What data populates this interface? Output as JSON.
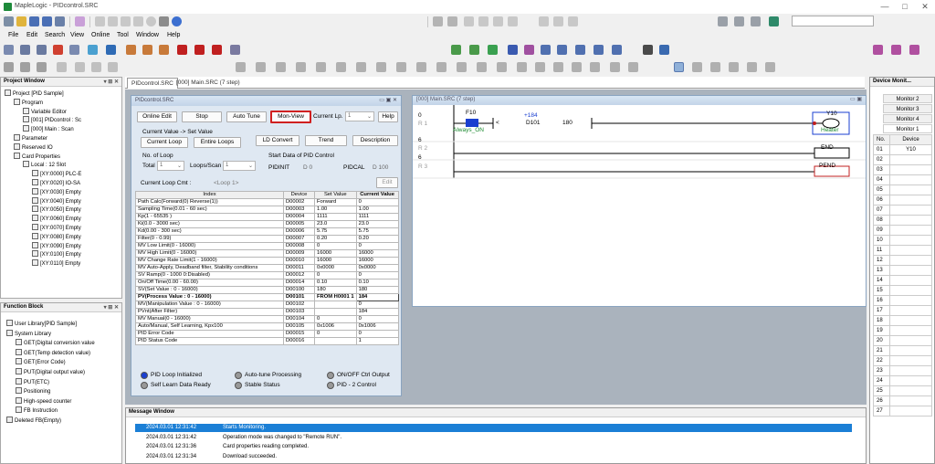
{
  "app": {
    "title": "MapleLogic - PIDcontrol.SRC"
  },
  "window_controls": [
    "—",
    "□",
    "✕"
  ],
  "menu": [
    "File",
    "Edit",
    "Search",
    "View",
    "Online",
    "Tool",
    "Window",
    "Help"
  ],
  "tabs": [
    "PIDcontrol.SRC",
    "[000] Main.SRC (7 step)"
  ],
  "project": {
    "title": "Project Window",
    "items": [
      {
        "label": "Project [PID Sample]",
        "level": 0
      },
      {
        "label": "Program",
        "level": 1
      },
      {
        "label": "Variable Editor",
        "level": 2
      },
      {
        "label": "[001] PIDcontrol : Sc",
        "level": 2
      },
      {
        "label": "[000] Main : Scan",
        "level": 2
      },
      {
        "label": "Parameter",
        "level": 1
      },
      {
        "label": "Reserved IO",
        "level": 1
      },
      {
        "label": "Card Properties",
        "level": 1
      },
      {
        "label": "Local : 12 Slot",
        "level": 2
      },
      {
        "label": "[XY:0000] PLC-E",
        "level": 3
      },
      {
        "label": "[XY:0020] IO-SA",
        "level": 3
      },
      {
        "label": "[XY:0030] Empty",
        "level": 3
      },
      {
        "label": "[XY:0040] Empty",
        "level": 3
      },
      {
        "label": "[XY:0050] Empty",
        "level": 3
      },
      {
        "label": "[XY:0060] Empty",
        "level": 3
      },
      {
        "label": "[XY:0070] Empty",
        "level": 3
      },
      {
        "label": "[XY:0080] Empty",
        "level": 3
      },
      {
        "label": "[XY:0090] Empty",
        "level": 3
      },
      {
        "label": "[XY:0100] Empty",
        "level": 3
      },
      {
        "label": "[XY:0110] Empty",
        "level": 3
      }
    ]
  },
  "function_block": {
    "title": "Function Block",
    "items": [
      {
        "label": "User Library[PID Sample]",
        "level": 0
      },
      {
        "label": "System Library",
        "level": 0
      },
      {
        "label": "GET(Digital conversion value",
        "level": 1
      },
      {
        "label": "GET(Temp detection value)",
        "level": 1
      },
      {
        "label": "GET(Error Code)",
        "level": 1
      },
      {
        "label": "PUT(Digital output value)",
        "level": 1
      },
      {
        "label": "PUT(ETC)",
        "level": 1
      },
      {
        "label": "Positioning",
        "level": 1
      },
      {
        "label": "High-speed counter",
        "level": 1
      },
      {
        "label": "FB Instruction",
        "level": 1
      },
      {
        "label": "Deleted FB(Empty)",
        "level": 0
      }
    ]
  },
  "pid": {
    "title": "PIDcontrol.SRC",
    "buttons": {
      "online_edit": "Online Edit",
      "stop": "Stop",
      "auto_tune": "Auto Tune",
      "mon_view": "Mon-View",
      "help": "Help",
      "current_loop": "Current Loop",
      "entire_loops": "Entire Loops",
      "ld_convert": "LD Convert",
      "trend": "Trend",
      "description": "Description",
      "edit": "Edit"
    },
    "current_lp_label": "Current Lp.",
    "current_lp_value": "1",
    "current_value_label": "Current Value -> Set Value",
    "no_of_loop_label": "No. of Loop",
    "total_label": "Total",
    "total_value": "1",
    "loops_scan_label": "Loops/Scan",
    "loops_scan_value": "1",
    "start_data_label": "Start Data of PID Control",
    "pidinit_label": "PIDINIT",
    "pidinit_value": "D 0",
    "pidcal_label": "PIDCAL",
    "pidcal_value": "D 100",
    "loop_cmt_label": "Current Loop Cmt :",
    "loop_cmt_value": "<Loop 1>",
    "headers": [
      "Index",
      "Device",
      "Set Value",
      "Current Value"
    ],
    "rows": [
      [
        "Path Calc(Forward(0) Reverse(1))",
        "D00002",
        "Forward",
        "0"
      ],
      [
        "Sampling Time(0.01 - 60 sec)",
        "D00003",
        "1.00",
        "1.00"
      ],
      [
        "Kp(1 - 65535 )",
        "D00004",
        "1111",
        "1111"
      ],
      [
        "Ki(0.0 - 3000 sec)",
        "D00005",
        "23.0",
        "23.0"
      ],
      [
        "Kd(0.00 - 300 sec)",
        "D00006",
        "5.75",
        "5.75"
      ],
      [
        "Filter(0 - 0.99)",
        "D00007",
        "0.20",
        "0.20"
      ],
      [
        "MV Low Limit(0 - 16000)",
        "D00008",
        "0",
        "0"
      ],
      [
        "MV High Limit(0 - 16000)",
        "D00009",
        "16000",
        "16000"
      ],
      [
        "MV Change Rate Limit(1 - 16000)",
        "D00010",
        "16000",
        "16000"
      ],
      [
        "MV Auto-Apply, Deadband filter, Stability conditions",
        "D00011",
        "0x0000",
        "0x0000"
      ],
      [
        "SV Ramp(0 - 1000   0:Disabled)",
        "D00012",
        "0",
        "0"
      ],
      [
        "On/Off Time(0.00 - 60.00)",
        "D00014",
        "0.10",
        "0.10"
      ],
      [
        "SV(Set Value : 0 - 16000)",
        "D00100",
        "180",
        "180"
      ],
      [
        "PV(Process Value : 0 - 16000)",
        "D00101",
        "FROM H0001 1",
        "184"
      ],
      [
        "MV(Manipulation Value : 0 - 16000)",
        "D00102",
        "",
        "0"
      ],
      [
        "PVnt(After Filter)",
        "D00103",
        "",
        "184"
      ],
      [
        "MV Manual(0 - 16000)",
        "D00104",
        "0",
        "0"
      ],
      [
        "Auto/Manual, Self Learning, Kpx100",
        "D00105",
        "0x1006",
        "0x1006"
      ],
      [
        "PID Error Code",
        "D00015",
        "0",
        "0"
      ],
      [
        "PID Status Code",
        "D00016",
        "",
        "1"
      ]
    ],
    "status": {
      "loop_init": "PID Loop Initialized",
      "auto_tune_proc": "Auto-tune Processing",
      "onoff": "ON/OFF Ctrl Output",
      "self_learn": "Self Learn Data Ready",
      "stable": "Stable Status",
      "pid2": "PID - 2 Control"
    }
  },
  "ladder": {
    "title": "[000] Main.SRC (7 step)",
    "contact": "F10",
    "contact_comment": "Always_ON",
    "compare_op": "<",
    "compare_const": "+184",
    "compare_dev": "D101",
    "compare_val": "180",
    "coil": "Y10",
    "coil_comment": "Heater",
    "end": "END",
    "pend": "PEND",
    "steps": [
      "0",
      "6",
      "6"
    ],
    "rungs": [
      "R 1",
      "R 2",
      "R 3"
    ]
  },
  "message": {
    "title": "Message Window",
    "lines": [
      {
        "time": "2024.03.01 12:31:42",
        "text": "Starts Monitoring."
      },
      {
        "time": "2024.03.01 12:31:42",
        "text": "Operation mode was changed to \"Remote RUN\"."
      },
      {
        "time": "2024.03.01 12:31:36",
        "text": "Card properties reading completed."
      },
      {
        "time": "2024.03.01 12:31:34",
        "text": "Download succeeded."
      }
    ]
  },
  "device_monitor": {
    "title": "Device Monit...",
    "tabs": [
      "Monitor 2",
      "Monitor 3",
      "Monitor 4",
      "Monitor 1"
    ],
    "headers": [
      "No.",
      "Device"
    ],
    "rows": [
      [
        "01",
        "Y10"
      ],
      [
        "02",
        ""
      ],
      [
        "03",
        ""
      ],
      [
        "04",
        ""
      ],
      [
        "05",
        ""
      ],
      [
        "06",
        ""
      ],
      [
        "07",
        ""
      ],
      [
        "08",
        ""
      ],
      [
        "09",
        ""
      ],
      [
        "10",
        ""
      ],
      [
        "11",
        ""
      ],
      [
        "12",
        ""
      ],
      [
        "13",
        ""
      ],
      [
        "14",
        ""
      ],
      [
        "15",
        ""
      ],
      [
        "16",
        ""
      ],
      [
        "17",
        ""
      ],
      [
        "18",
        ""
      ],
      [
        "19",
        ""
      ],
      [
        "20",
        ""
      ],
      [
        "21",
        ""
      ],
      [
        "22",
        ""
      ],
      [
        "23",
        ""
      ],
      [
        "24",
        ""
      ],
      [
        "25",
        ""
      ],
      [
        "26",
        ""
      ],
      [
        "27",
        ""
      ]
    ]
  }
}
